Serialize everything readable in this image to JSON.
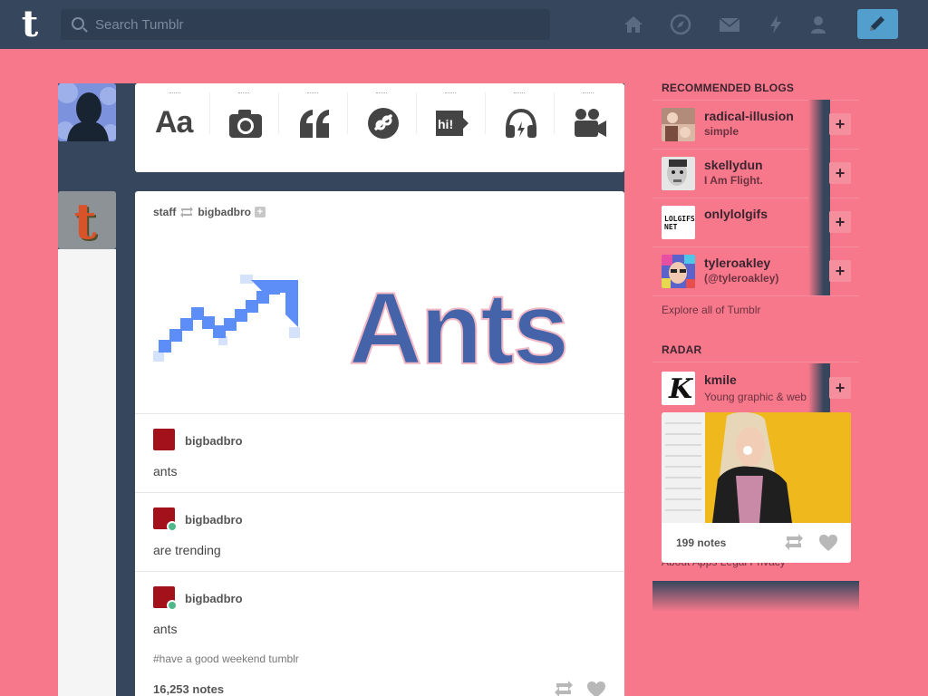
{
  "header": {
    "logo": "t",
    "search_placeholder": "Search Tumblr"
  },
  "post_types": [
    "text",
    "photo",
    "quote",
    "link",
    "chat",
    "audio",
    "video"
  ],
  "post_types_text_label": "Aa",
  "post_types_chat_label": "hi!",
  "post": {
    "author": "staff",
    "reblogged_from": "bigbadbro",
    "image_text": "Ants",
    "blocks": [
      {
        "name": "bigbadbro",
        "body": "ants"
      },
      {
        "name": "bigbadbro",
        "body": "are trending"
      },
      {
        "name": "bigbadbro",
        "body": "ants"
      }
    ],
    "tags": "#have a good weekend tumblr",
    "notes": "16,253 notes"
  },
  "sidebar": {
    "recommended_title": "RECOMMENDED BLOGS",
    "blogs": [
      {
        "name": "radical-illusion",
        "title": "simple"
      },
      {
        "name": "skellydun",
        "title": "I Am Flight."
      },
      {
        "name": "onlylolgifs",
        "title": ""
      },
      {
        "name": "tyleroakley",
        "title": "(@tyleroakley)"
      }
    ],
    "lolgifs_thumb_text": "LOLGIFS. NET",
    "explore": "Explore all of Tumblr",
    "radar_title": "RADAR",
    "radar": {
      "name": "kmile",
      "title": "Young graphic & web d",
      "thumb_letter": "K",
      "notes": "199 notes"
    },
    "footer_links": "About  Apps  Legal  Privacy"
  },
  "colors": {
    "navy": "#36465d",
    "background": "#f7788a",
    "accent": "#529ecc"
  }
}
